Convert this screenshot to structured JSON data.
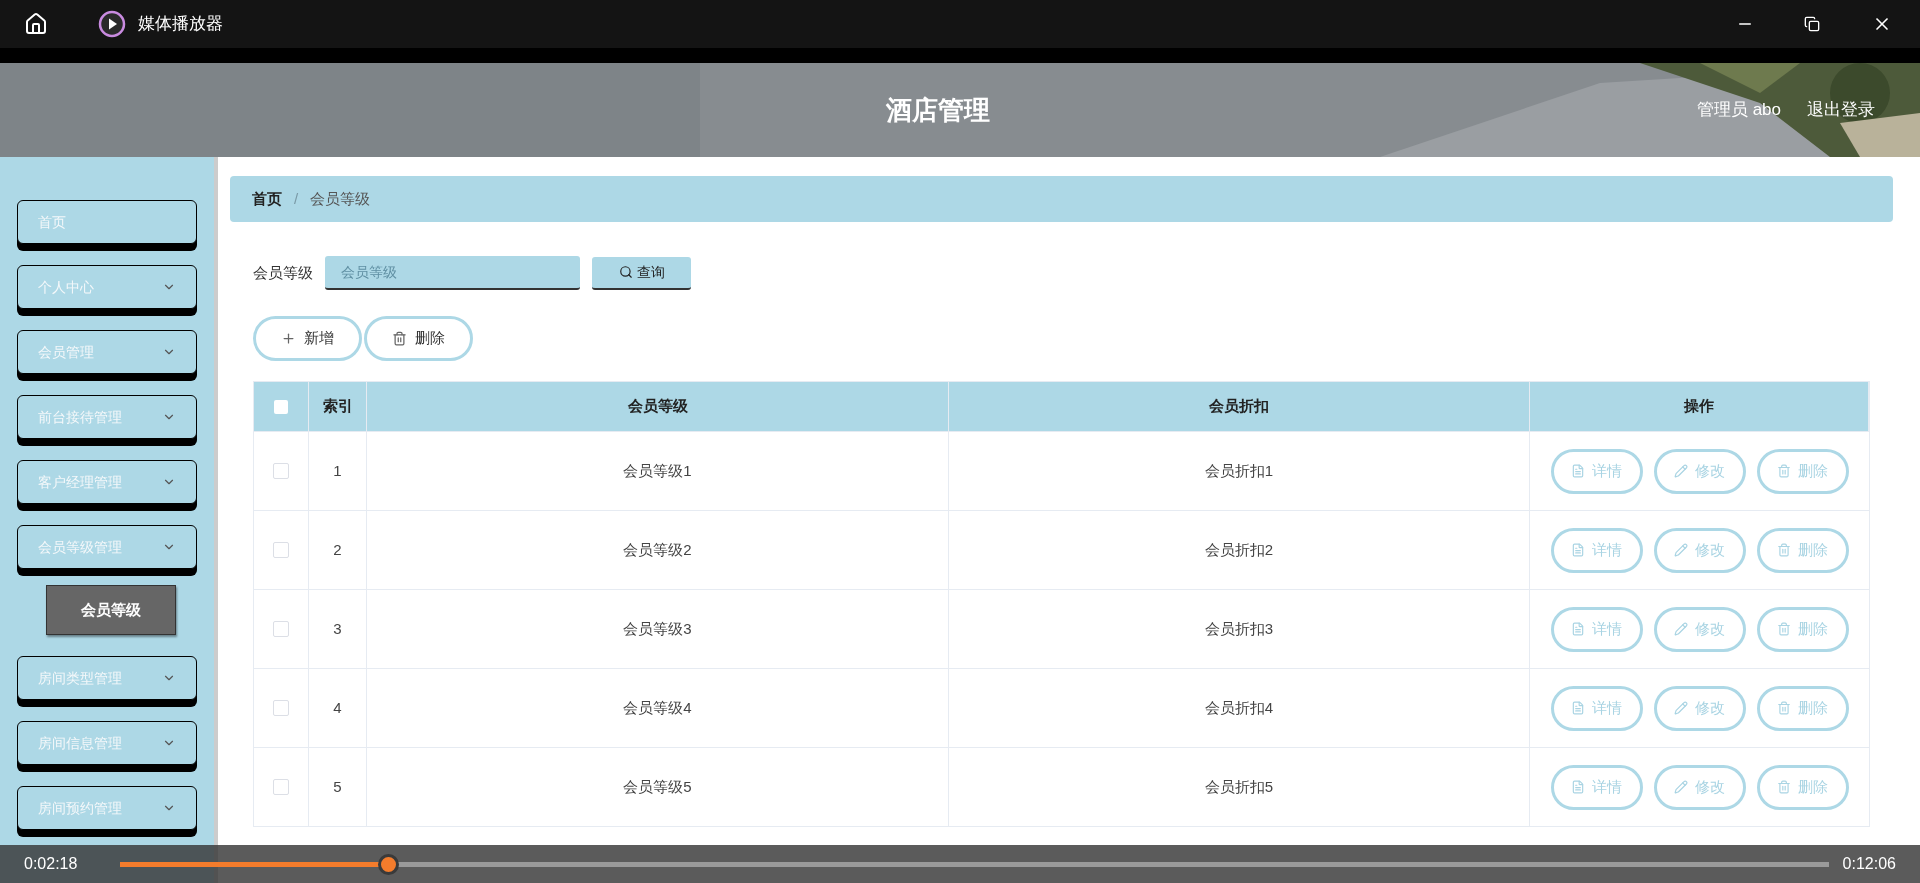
{
  "window": {
    "title": "媒体播放器"
  },
  "header": {
    "title": "酒店管理",
    "user": "管理员 abo",
    "logout": "退出登录"
  },
  "sidebar": {
    "items": [
      {
        "label": "首页",
        "kind": "link"
      },
      {
        "label": "个人中心",
        "kind": "menu"
      },
      {
        "label": "会员管理",
        "kind": "menu"
      },
      {
        "label": "前台接待管理",
        "kind": "menu"
      },
      {
        "label": "客户经理管理",
        "kind": "menu"
      },
      {
        "label": "会员等级管理",
        "kind": "menu",
        "children": [
          {
            "label": "会员等级",
            "selected": true
          }
        ]
      },
      {
        "label": "房间类型管理",
        "kind": "menu"
      },
      {
        "label": "房间信息管理",
        "kind": "menu"
      },
      {
        "label": "房间预约管理",
        "kind": "menu"
      }
    ]
  },
  "breadcrumb": {
    "items": [
      "首页",
      "会员等级"
    ],
    "separator": "/"
  },
  "search": {
    "label": "会员等级",
    "placeholder": "会员等级",
    "button": "查询"
  },
  "actions": [
    "新增",
    "删除"
  ],
  "table": {
    "all_checked": false,
    "columns": [
      "索引",
      "会员等级",
      "会员折扣",
      "操作"
    ],
    "rows": [
      {
        "index": "1",
        "level": "会员等级1",
        "discount": "会员折扣1",
        "checked": false,
        "buttons": [
          "详情",
          "修改",
          "删除"
        ]
      },
      {
        "index": "2",
        "level": "会员等级2",
        "discount": "会员折扣2",
        "checked": false,
        "buttons": [
          "详情",
          "修改",
          "删除"
        ]
      },
      {
        "index": "3",
        "level": "会员等级3",
        "discount": "会员折扣3",
        "checked": false,
        "buttons": [
          "详情",
          "修改",
          "删除"
        ]
      },
      {
        "index": "4",
        "level": "会员等级4",
        "discount": "会员折扣4",
        "checked": false,
        "buttons": [
          "详情",
          "修改",
          "删除"
        ]
      },
      {
        "index": "5",
        "level": "会员等级5",
        "discount": "会员折扣5",
        "checked": false,
        "buttons": [
          "详情",
          "修改",
          "删除"
        ]
      }
    ]
  },
  "player": {
    "elapsed": "0:02:18",
    "total": "0:12:06",
    "progress": {
      "level": 0.157
    }
  }
}
